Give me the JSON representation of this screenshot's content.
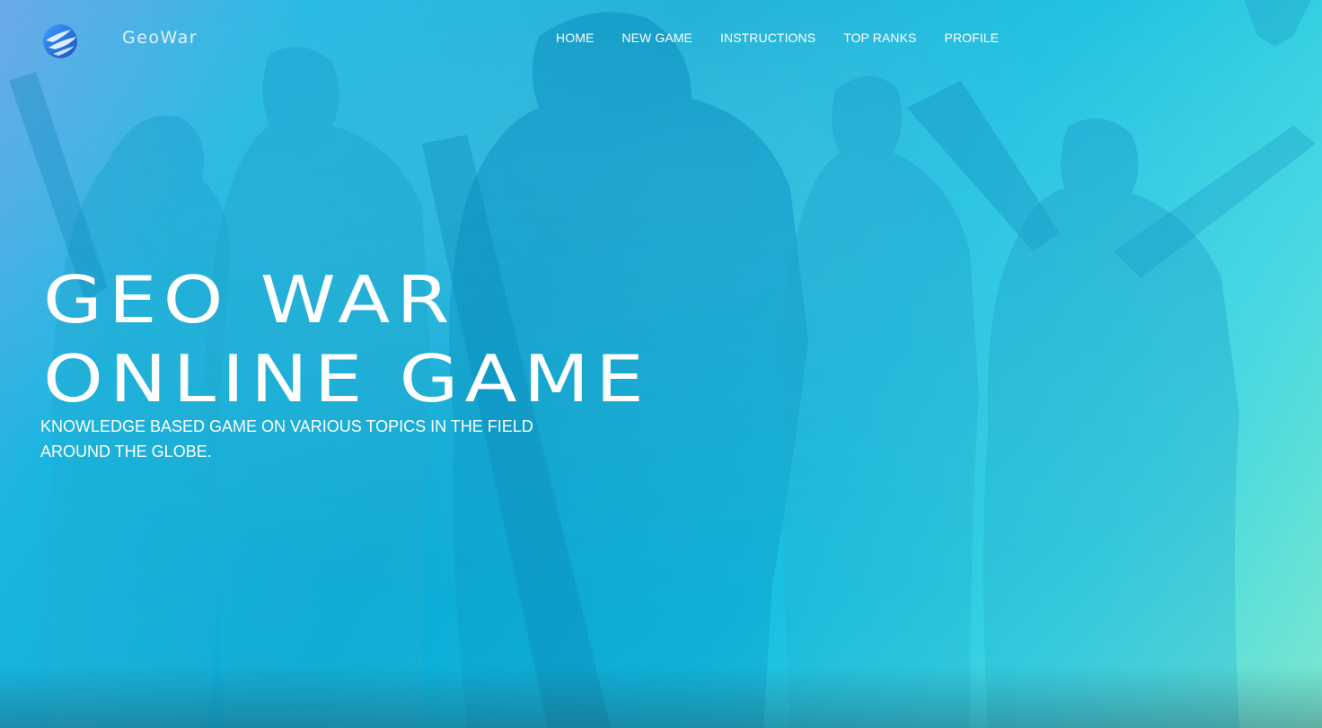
{
  "brand": {
    "name": "GeoWar",
    "logo_icon": "globe-swoosh-icon"
  },
  "nav": {
    "items": [
      {
        "label": "HOME"
      },
      {
        "label": "NEW GAME"
      },
      {
        "label": "INSTRUCTIONS"
      },
      {
        "label": "TOP RANKS"
      },
      {
        "label": "PROFILE"
      }
    ]
  },
  "hero": {
    "headline_line1": "GEO WAR",
    "headline_line2": "ONLINE GAME",
    "subtitle": "KNOWLEDGE BASED GAME ON VARIOUS TOPICS IN THE FIELD AROUND THE GLOBE."
  },
  "colors": {
    "overlay_start": "#6aa8e8",
    "overlay_mid": "#0aa9d4",
    "overlay_end": "#7ce8cf",
    "text": "#ffffff"
  }
}
